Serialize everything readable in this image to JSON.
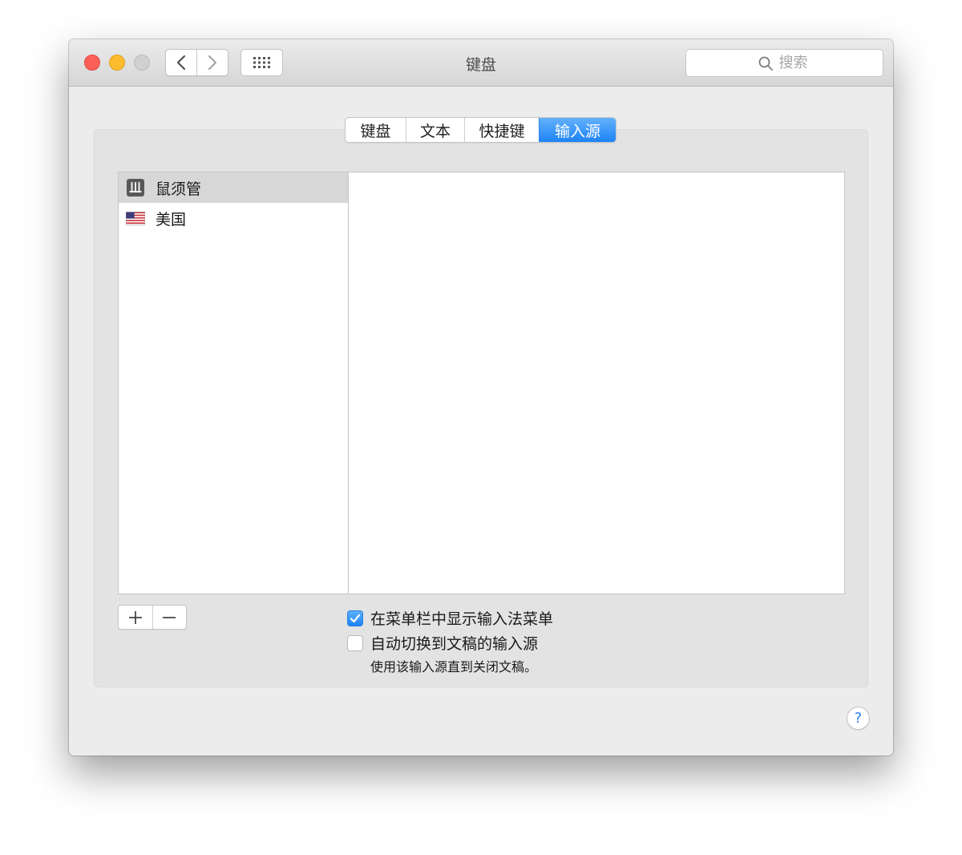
{
  "window": {
    "title": "键盘"
  },
  "toolbar": {
    "back_icon": "chevron-left-icon",
    "forward_icon": "chevron-right-icon",
    "show_all_icon": "grid-icon",
    "search_placeholder": "搜索",
    "search_icon": "search-icon"
  },
  "tabs": [
    {
      "label": "键盘",
      "active": false
    },
    {
      "label": "文本",
      "active": false
    },
    {
      "label": "快捷键",
      "active": false
    },
    {
      "label": "输入源",
      "active": true
    }
  ],
  "input_sources": [
    {
      "label": "鼠须管",
      "icon": "squirrel-input-icon",
      "selected": true
    },
    {
      "label": "美国",
      "icon": "us-flag-icon",
      "selected": false
    }
  ],
  "controls": {
    "add_icon": "plus-icon",
    "remove_icon": "minus-icon"
  },
  "options": {
    "show_menu": {
      "label": "在菜单栏中显示输入法菜单",
      "checked": true
    },
    "auto_switch": {
      "label": "自动切换到文稿的输入源",
      "checked": false
    },
    "auto_switch_note": "使用该输入源直到关闭文稿。"
  },
  "help": {
    "label": "?"
  },
  "colors": {
    "accent": "#1d83f5",
    "close": "#fc5f57",
    "minimize": "#fdbc2e",
    "zoom_disabled": "#d0d0d0"
  }
}
